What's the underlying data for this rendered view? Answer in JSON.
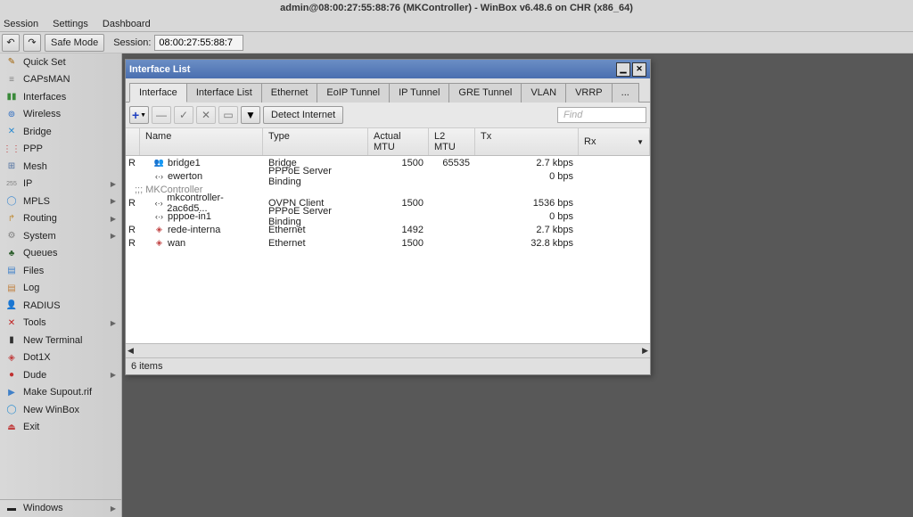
{
  "title": "admin@08:00:27:55:88:76 (MKController) - WinBox v6.48.6 on CHR (x86_64)",
  "menu": {
    "session": "Session",
    "settings": "Settings",
    "dashboard": "Dashboard"
  },
  "toolbar": {
    "undo": "↶",
    "redo": "↷",
    "safemode": "Safe Mode",
    "session_label": "Session:",
    "session_value": "08:00:27:55:88:7"
  },
  "sidebar": {
    "items": [
      {
        "icon": "✎",
        "iconColor": "#a06000",
        "label": "Quick Set"
      },
      {
        "icon": "≡",
        "iconColor": "#808080",
        "label": "CAPsMAN"
      },
      {
        "icon": "▮▮",
        "iconColor": "#3a8a3a",
        "label": "Interfaces"
      },
      {
        "icon": "⊚",
        "iconColor": "#2a6ac0",
        "label": "Wireless"
      },
      {
        "icon": "✕",
        "iconColor": "#2a8acf",
        "label": "Bridge"
      },
      {
        "icon": "⋮⋮",
        "iconColor": "#c04040",
        "label": "PPP"
      },
      {
        "icon": "⊞",
        "iconColor": "#5070a0",
        "label": "Mesh"
      },
      {
        "icon": "255",
        "iconColor": "#808080",
        "label": "IP",
        "chev": true,
        "small": true
      },
      {
        "icon": "◯",
        "iconColor": "#4a90d0",
        "label": "MPLS",
        "chev": true
      },
      {
        "icon": "↱",
        "iconColor": "#c09040",
        "label": "Routing",
        "chev": true
      },
      {
        "icon": "⚙",
        "iconColor": "#808080",
        "label": "System",
        "chev": true
      },
      {
        "icon": "♣",
        "iconColor": "#306030",
        "label": "Queues"
      },
      {
        "icon": "▤",
        "iconColor": "#4080c8",
        "label": "Files"
      },
      {
        "icon": "▤",
        "iconColor": "#c08040",
        "label": "Log"
      },
      {
        "icon": "👤",
        "iconColor": "#d0a030",
        "label": "RADIUS"
      },
      {
        "icon": "✕",
        "iconColor": "#c02020",
        "label": "Tools",
        "chev": true
      },
      {
        "icon": "▮",
        "iconColor": "#303030",
        "label": "New Terminal"
      },
      {
        "icon": "◈",
        "iconColor": "#c04040",
        "label": "Dot1X"
      },
      {
        "icon": "●",
        "iconColor": "#c03030",
        "label": "Dude",
        "chev": true
      },
      {
        "icon": "▶",
        "iconColor": "#4080c8",
        "label": "Make Supout.rif"
      },
      {
        "icon": "◯",
        "iconColor": "#3090d0",
        "label": "New WinBox"
      },
      {
        "icon": "⏏",
        "iconColor": "#c04040",
        "label": "Exit"
      }
    ],
    "windows": {
      "icon": "▬",
      "iconColor": "#4080c8",
      "label": "Windows"
    }
  },
  "win": {
    "title": "Interface List",
    "tabs": [
      "Interface",
      "Interface List",
      "Ethernet",
      "EoIP Tunnel",
      "IP Tunnel",
      "GRE Tunnel",
      "VLAN",
      "VRRP",
      "..."
    ],
    "detect": "Detect Internet",
    "find": "Find",
    "cols": {
      "name": "Name",
      "type": "Type",
      "amtu": "Actual MTU",
      "l2mtu": "L2 MTU",
      "tx": "Tx",
      "rx": "Rx"
    },
    "rows": [
      {
        "flag": "R",
        "ico": "👥",
        "icoColor": "#3a7ac0",
        "name": "bridge1",
        "type": "Bridge",
        "amtu": "1500",
        "l2mtu": "65535",
        "tx": "2.7 kbps"
      },
      {
        "flag": "",
        "ico": "‹·›",
        "icoColor": "#333",
        "name": "ewerton",
        "type": "PPPoE Server Binding",
        "amtu": "",
        "l2mtu": "",
        "tx": "0 bps"
      },
      {
        "sep": ";;; MKController"
      },
      {
        "flag": "R",
        "ico": "‹·›",
        "icoColor": "#333",
        "name": "mkcontroller-2ac6d5...",
        "type": "OVPN Client",
        "amtu": "1500",
        "l2mtu": "",
        "tx": "1536 bps"
      },
      {
        "flag": "",
        "ico": "‹·›",
        "icoColor": "#333",
        "name": "pppoe-in1",
        "type": "PPPoE Server Binding",
        "amtu": "",
        "l2mtu": "",
        "tx": "0 bps"
      },
      {
        "flag": "R",
        "ico": "◈",
        "icoColor": "#c04040",
        "name": "rede-interna",
        "type": "Ethernet",
        "amtu": "1492",
        "l2mtu": "",
        "tx": "2.7 kbps"
      },
      {
        "flag": "R",
        "ico": "◈",
        "icoColor": "#c04040",
        "name": "wan",
        "type": "Ethernet",
        "amtu": "1500",
        "l2mtu": "",
        "tx": "32.8 kbps"
      }
    ],
    "itemcount": "6 items"
  }
}
